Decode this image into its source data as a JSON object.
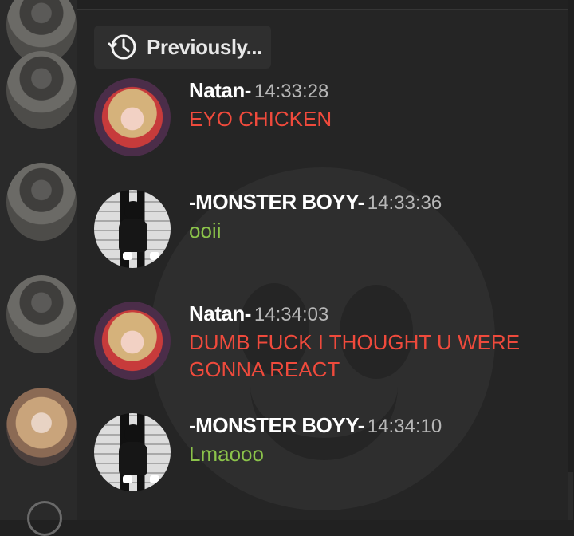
{
  "header": {
    "previous_label": "Previously..."
  },
  "messages": [
    {
      "author": "Natan-",
      "time": "14:33:28",
      "text": "EYO CHICKEN",
      "color": "#ef4a3c"
    },
    {
      "author": "-MONSTER BOYY-",
      "time": "14:33:36",
      "text": "ooii",
      "color": "#8bc34a"
    },
    {
      "author": "Natan-",
      "time": "14:34:03",
      "text": "DUMB FUCK I THOUGHT U WERE GONNA REACT",
      "color": "#ef4a3c"
    },
    {
      "author": "-MONSTER BOYY-",
      "time": "14:34:10",
      "text": "Lmaooo",
      "color": "#8bc34a"
    }
  ],
  "icons": {
    "history": "history-icon",
    "bottom": "circle-icon"
  }
}
